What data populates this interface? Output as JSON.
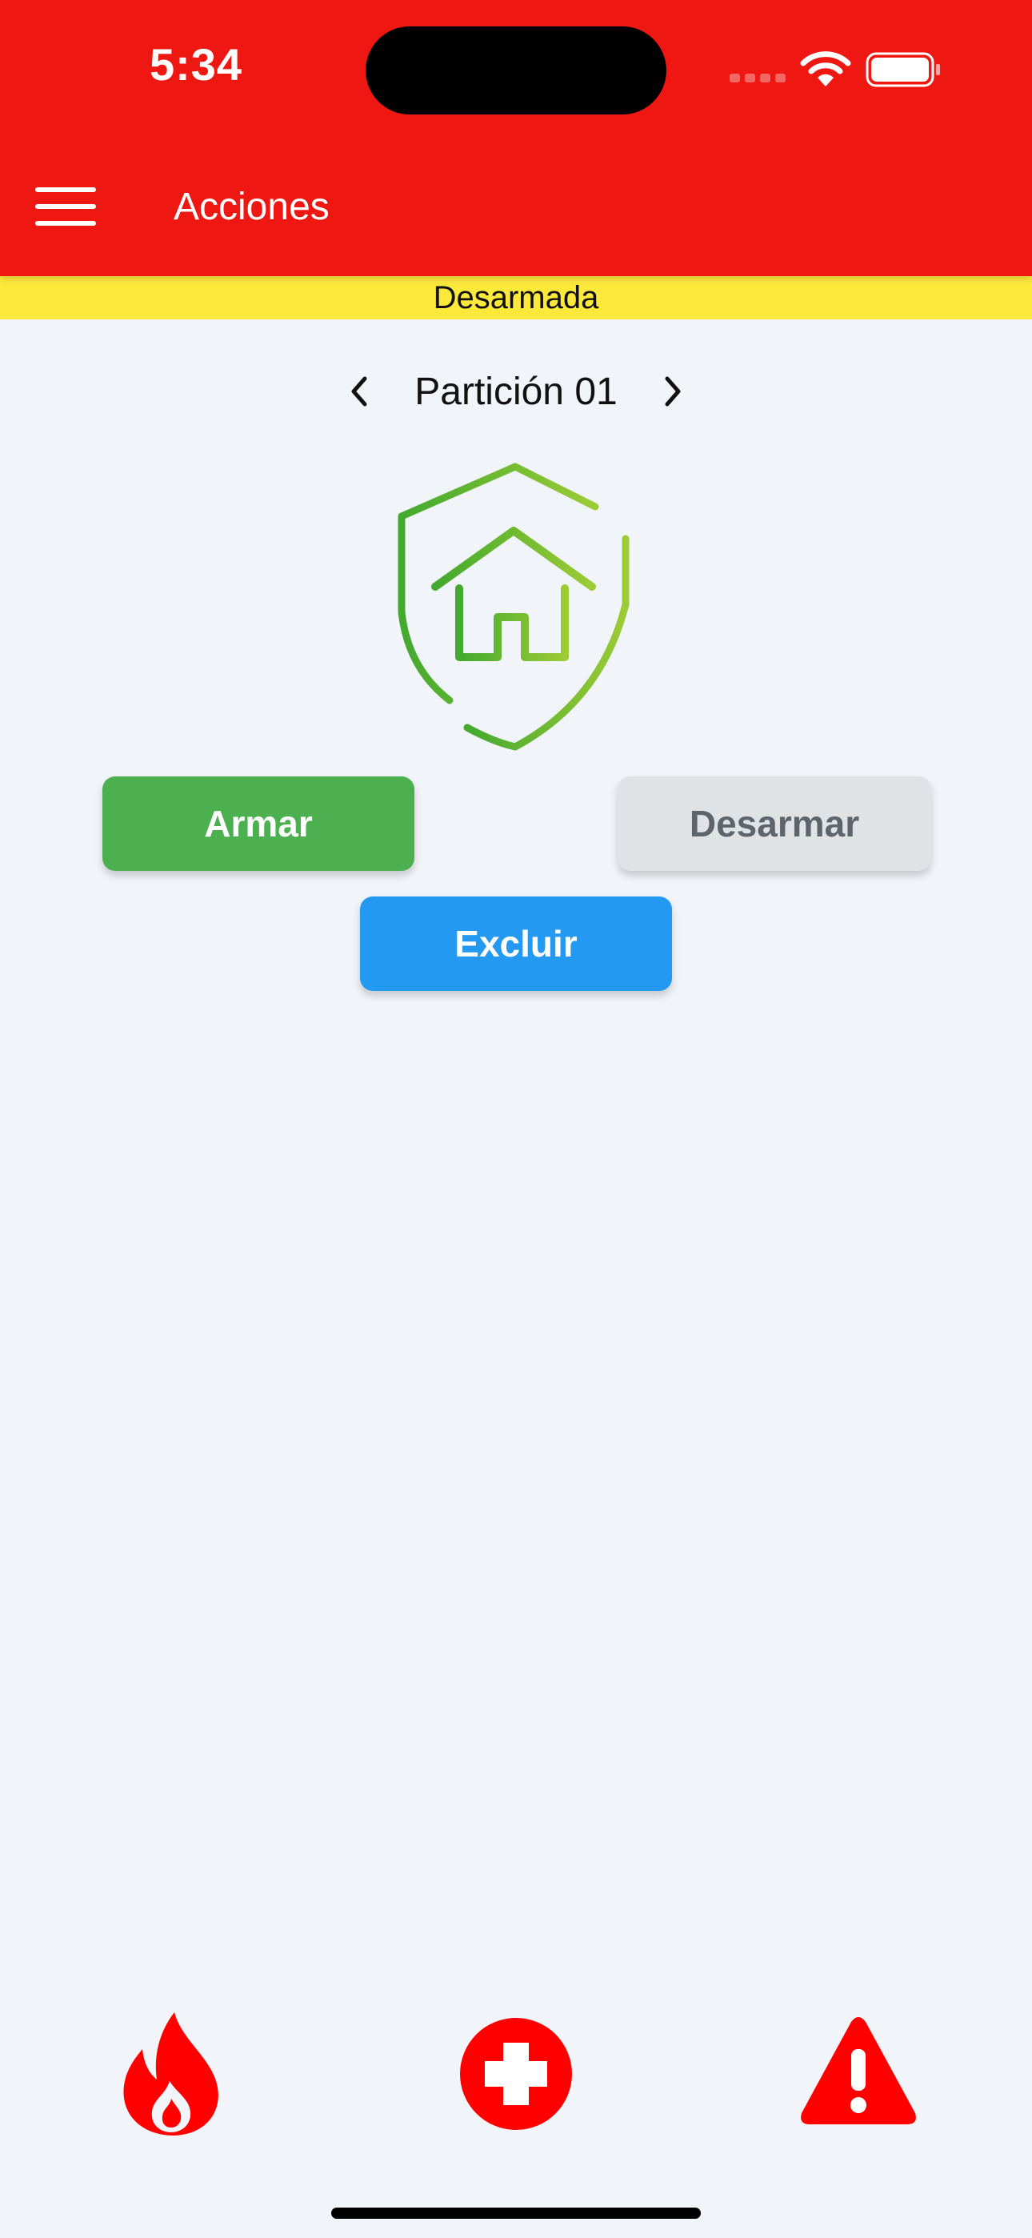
{
  "status_bar": {
    "time": "5:34"
  },
  "app_bar": {
    "title": "Acciones",
    "menu_icon": "hamburger-menu-icon"
  },
  "system_state": {
    "label": "Desarmada",
    "color": "#fde93c"
  },
  "partition": {
    "label": "Partición 01",
    "prev_icon": "chevron-left-icon",
    "next_icon": "chevron-right-icon"
  },
  "status_graphic": {
    "icon": "shield-home-icon",
    "color": "#4caf2e"
  },
  "actions": {
    "arm_label": "Armar",
    "disarm_label": "Desarmar",
    "exclude_label": "Excluir"
  },
  "emergency_bar": {
    "items": [
      {
        "icon": "fire-icon",
        "color": "#ff0000"
      },
      {
        "icon": "medical-cross-icon",
        "color": "#ff0000"
      },
      {
        "icon": "warning-triangle-icon",
        "color": "#ff0000"
      }
    ]
  },
  "theme": {
    "primary": "#ef1712",
    "background": "#f1f4f8",
    "arm": "#4cb050",
    "disarm": "#e0e3e6",
    "exclude": "#2399f1"
  }
}
